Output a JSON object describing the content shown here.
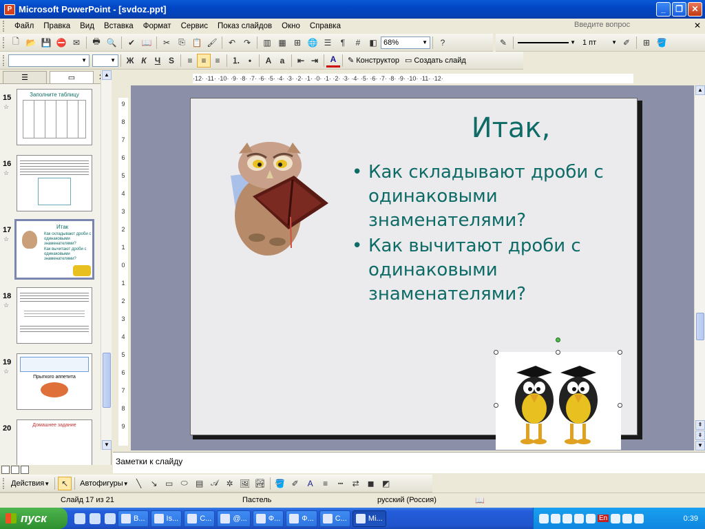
{
  "window": {
    "title": "Microsoft PowerPoint - [svdoz.ppt]",
    "app_icon": "P"
  },
  "menu": {
    "items": [
      "Файл",
      "Правка",
      "Вид",
      "Вставка",
      "Формат",
      "Сервис",
      "Показ слайдов",
      "Окно",
      "Справка"
    ],
    "help_placeholder": "Введите вопрос"
  },
  "toolbar": {
    "zoom": "68%",
    "line_width": "1 пт",
    "designer_label": "Конструктор",
    "new_slide_label": "Создать слайд",
    "bold": "Ж",
    "italic": "К",
    "underline": "Ч",
    "shadow": "S",
    "font_color_letter": "A"
  },
  "left_panel": {
    "tabs": [
      "outline",
      "slides"
    ],
    "slides": [
      {
        "num": "15",
        "title": "Заполните таблицу"
      },
      {
        "num": "16",
        "title": ""
      },
      {
        "num": "17",
        "title": "Итак",
        "b1": "Как складывают дроби с одинаковыми знаменателями?",
        "b2": "Как вычитают дроби с одинаковыми знаменателями?"
      },
      {
        "num": "18",
        "title": ""
      },
      {
        "num": "19",
        "title": "Прыткого аппетита"
      },
      {
        "num": "20",
        "title": "Домашнее задание"
      }
    ]
  },
  "ruler": {
    "horizontal": "·12· ·11· ·10· ·9· ·8· ·7· ·6· ·5· ·4· ·3· ·2· ·1· ·0· ·1· ·2· ·3· ·4· ·5· ·6· ·7· ·8· ·9· ·10· ·11· ·12·",
    "vertical": [
      "9",
      "8",
      "7",
      "6",
      "5",
      "4",
      "3",
      "2",
      "1",
      "0",
      "1",
      "2",
      "3",
      "4",
      "5",
      "6",
      "7",
      "8",
      "9"
    ]
  },
  "slide": {
    "title": "Итак,",
    "bullet1": "Как складывают дроби с одинаковыми знаменателями?",
    "bullet2": "Как вычитают  дроби с одинаковыми знаменателями?"
  },
  "notes": {
    "placeholder": "Заметки к слайду"
  },
  "draw_toolbar": {
    "actions_label": "Действия",
    "autoshapes_label": "Автофигуры"
  },
  "status": {
    "slide_counter": "Слайд 17 из 21",
    "design": "Пастель",
    "language": "русский (Россия)"
  },
  "taskbar": {
    "start_label": "пуск",
    "tasks": [
      "В...",
      "Is...",
      "С...",
      "@...",
      "Ф...",
      "Ф...",
      "С...",
      "Mi..."
    ],
    "clock": "0:39",
    "lang_indicator": "En"
  },
  "colors": {
    "slide_text": "#0e6b66",
    "titlebar": "#0246c4",
    "workspace": "#8c8fa8"
  }
}
